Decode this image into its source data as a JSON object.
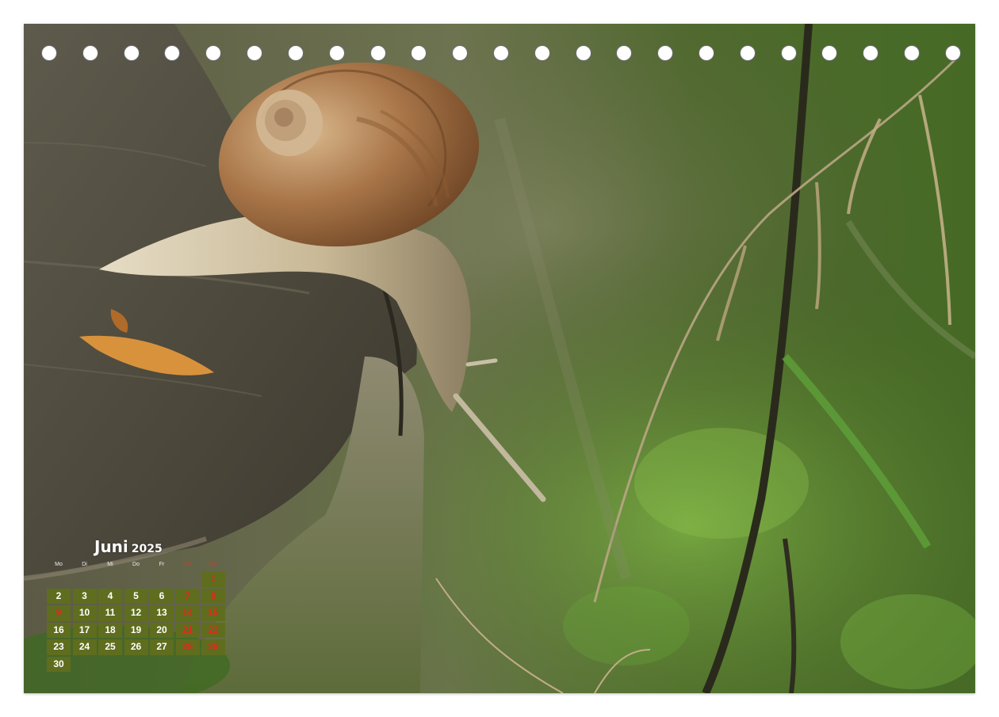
{
  "calendar": {
    "month": "Juni",
    "year": "2025",
    "weekdays": [
      "Mo",
      "Di",
      "Mi",
      "Do",
      "Fr",
      "Sa",
      "So"
    ],
    "weeks": [
      [
        "",
        "",
        "",
        "",
        "",
        "",
        "1"
      ],
      [
        "2",
        "3",
        "4",
        "5",
        "6",
        "7",
        "8"
      ],
      [
        "9",
        "10",
        "11",
        "12",
        "13",
        "14",
        "15"
      ],
      [
        "16",
        "17",
        "18",
        "19",
        "20",
        "21",
        "22"
      ],
      [
        "23",
        "24",
        "25",
        "26",
        "27",
        "28",
        "29"
      ],
      [
        "30",
        "",
        "",
        "",
        "",
        "",
        ""
      ]
    ],
    "holidays": [
      "9"
    ],
    "colors": {
      "cell": "#5f6d1e",
      "weekend_text": "#e02a1c",
      "text": "#ffffff"
    }
  },
  "binding": {
    "hole_count": 23
  },
  "photo": {
    "subject": "snail-on-tree-stump"
  }
}
